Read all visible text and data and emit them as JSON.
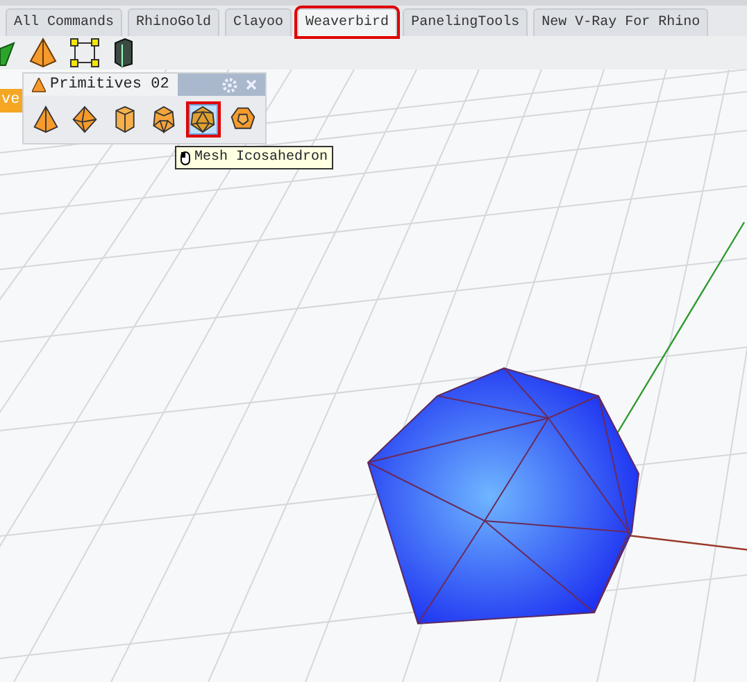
{
  "tabs": [
    {
      "label": "All Commands",
      "selected": false,
      "highlighted": false
    },
    {
      "label": "RhinoGold",
      "selected": false,
      "highlighted": false
    },
    {
      "label": "Clayoo",
      "selected": false,
      "highlighted": false
    },
    {
      "label": "Weaverbird",
      "selected": true,
      "highlighted": true
    },
    {
      "label": "PanelingTools",
      "selected": false,
      "highlighted": false
    },
    {
      "label": "New V-Ray For Rhino",
      "selected": false,
      "highlighted": false
    }
  ],
  "side_tab": {
    "label": "ve"
  },
  "palette": {
    "title": "Primitives 02",
    "buttons": [
      {
        "kind": "pyramid",
        "selected": false,
        "highlighted": false
      },
      {
        "kind": "octahedron",
        "selected": false,
        "highlighted": false
      },
      {
        "kind": "prism",
        "selected": false,
        "highlighted": false
      },
      {
        "kind": "faceted",
        "selected": false,
        "highlighted": false
      },
      {
        "kind": "icosahedron",
        "selected": true,
        "highlighted": true
      },
      {
        "kind": "dodecahedron",
        "selected": false,
        "highlighted": false
      }
    ],
    "tooltip": "Mesh Icosahedron"
  }
}
